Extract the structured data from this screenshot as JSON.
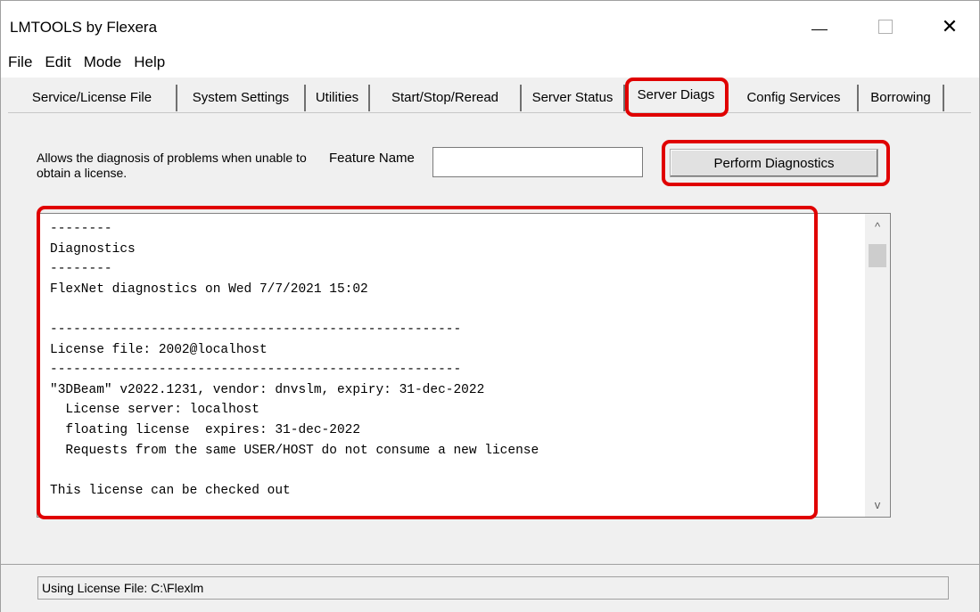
{
  "window": {
    "title": "LMTOOLS by Flexera",
    "minimize_symbol": "",
    "maximize_symbol": "",
    "close_symbol": "✕"
  },
  "menu": [
    "File",
    "Edit",
    "Mode",
    "Help"
  ],
  "tabs": [
    {
      "label": "Service/License File",
      "active": false
    },
    {
      "label": "System Settings",
      "active": false
    },
    {
      "label": "Utilities",
      "active": false
    },
    {
      "label": "Start/Stop/Reread",
      "active": false
    },
    {
      "label": "Server Status",
      "active": false
    },
    {
      "label": "Server Diags",
      "active": true
    },
    {
      "label": "Config Services",
      "active": false
    },
    {
      "label": "Borrowing",
      "active": false
    }
  ],
  "server_diags": {
    "description": "Allows the diagnosis of problems when unable to obtain a license.",
    "feature_label": "Feature Name",
    "feature_value": "",
    "perform_button": "Perform Diagnostics",
    "output_lines": [
      "--------",
      "Diagnostics",
      "--------",
      "FlexNet diagnostics on Wed 7/7/2021 15:02",
      "",
      "-----------------------------------------------------",
      "License file: 2002@localhost",
      "-----------------------------------------------------",
      "\"3DBeam\" v2022.1231, vendor: dnvslm, expiry: 31-dec-2022",
      "  License server: localhost",
      "  floating license  expires: 31-dec-2022",
      "  Requests from the same USER/HOST do not consume a new license",
      "",
      "This license can be checked out"
    ]
  },
  "scrollbar": {
    "up_icon": "^",
    "down_icon": "v"
  },
  "status": {
    "text": "Using License File:  C:\\Flexlm"
  },
  "colors": {
    "highlight": "#e00000",
    "window_bg": "#f0f0f0"
  }
}
